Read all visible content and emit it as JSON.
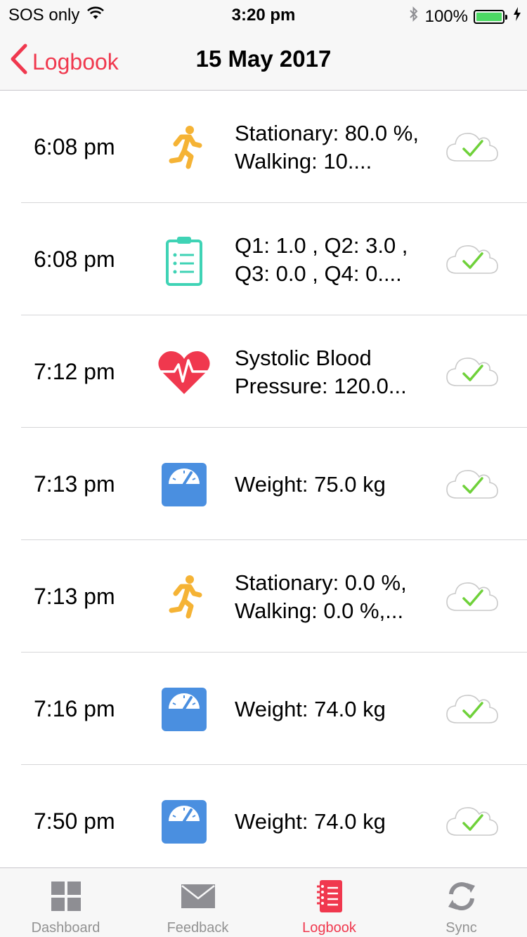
{
  "status_bar": {
    "carrier": "SOS only",
    "time": "3:20 pm",
    "battery": "100%",
    "icons": [
      "wifi-icon",
      "bluetooth-icon",
      "battery-icon",
      "charging-icon"
    ]
  },
  "nav": {
    "back_label": "Logbook",
    "title": "15 May 2017"
  },
  "entries": [
    {
      "time": "6:08 pm",
      "icon": "activity-runner-icon",
      "text": "Stationary: 80.0 %, Walking: 10....",
      "status": "cloud-synced-icon"
    },
    {
      "time": "6:08 pm",
      "icon": "clipboard-questionnaire-icon",
      "text": "Q1: 1.0 , Q2: 3.0 , Q3: 0.0 , Q4: 0....",
      "status": "cloud-synced-icon"
    },
    {
      "time": "7:12 pm",
      "icon": "heart-pulse-icon",
      "text": "Systolic Blood Pressure: 120.0...",
      "status": "cloud-synced-icon"
    },
    {
      "time": "7:13 pm",
      "icon": "weight-scale-icon",
      "text": "Weight: 75.0 kg",
      "status": "cloud-synced-icon"
    },
    {
      "time": "7:13 pm",
      "icon": "activity-runner-icon",
      "text": "Stationary: 0.0 %, Walking: 0.0 %,...",
      "status": "cloud-synced-icon"
    },
    {
      "time": "7:16 pm",
      "icon": "weight-scale-icon",
      "text": "Weight: 74.0 kg",
      "status": "cloud-synced-icon"
    },
    {
      "time": "7:50 pm",
      "icon": "weight-scale-icon",
      "text": "Weight: 74.0 kg",
      "status": "cloud-synced-icon"
    }
  ],
  "tabs": [
    {
      "label": "Dashboard",
      "icon": "dashboard-grid-icon",
      "active": false
    },
    {
      "label": "Feedback",
      "icon": "envelope-icon",
      "active": false
    },
    {
      "label": "Logbook",
      "icon": "logbook-notebook-icon",
      "active": true
    },
    {
      "label": "Sync",
      "icon": "sync-arrows-icon",
      "active": false
    }
  ],
  "colors": {
    "accent": "#f0384e",
    "runner": "#f5b335",
    "clipboard": "#3fd3b5",
    "heart": "#f0384e",
    "scale": "#4a8fe0",
    "check": "#6fd13a",
    "inactive": "#929292"
  }
}
